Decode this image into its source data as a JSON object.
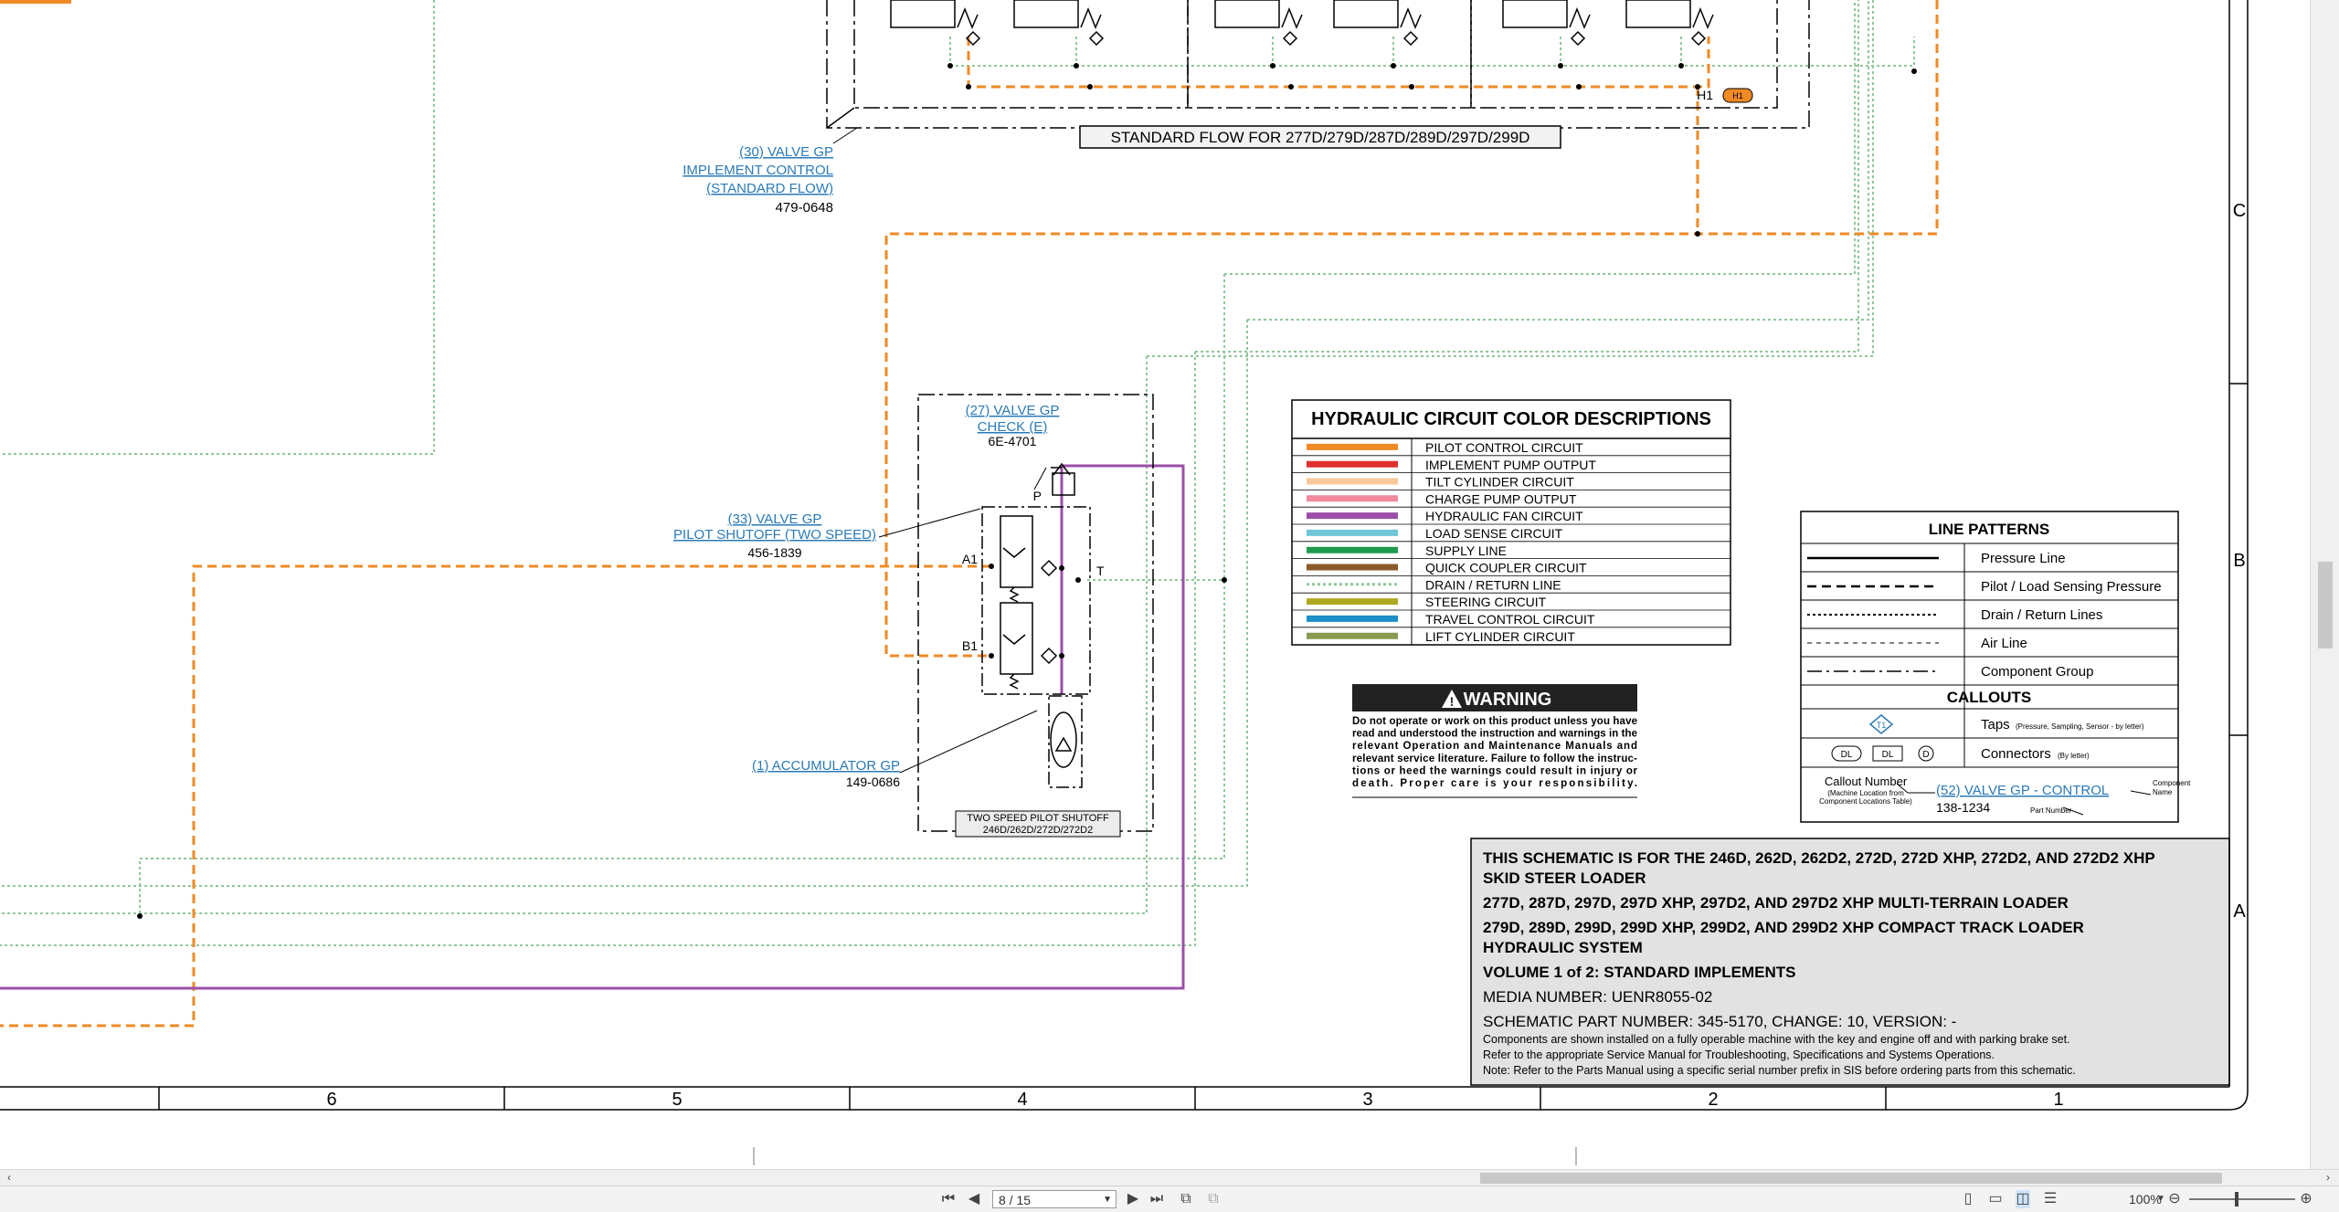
{
  "viewer": {
    "page_indicator": "8 / 15",
    "zoom": "100%",
    "grid_columns": [
      "6",
      "5",
      "4",
      "3",
      "2",
      "1"
    ],
    "grid_rows": [
      "C",
      "B",
      "A"
    ]
  },
  "schematic": {
    "standard_flow_label": "STANDARD FLOW FOR 277D/279D/287D/289D/297D/299D",
    "h1_label": "H1",
    "h1_tag": "H1",
    "valve30": {
      "line1": "(30) VALVE GP",
      "line2": "IMPLEMENT CONTROL",
      "line3": "(STANDARD FLOW)",
      "part": "479-0648"
    },
    "valve27": {
      "line1": "(27) VALVE GP",
      "line2": "CHECK (E)",
      "part": "6E-4701"
    },
    "valve33": {
      "line1": "(33) VALVE GP",
      "line2": "PILOT SHUTOFF (TWO SPEED)",
      "part": "456-1839"
    },
    "accumulator": {
      "line1": "(1) ACCUMULATOR GP",
      "part": "149-0686"
    },
    "port_p": "P",
    "port_t": "T",
    "port_a1": "A1",
    "port_b1": "B1",
    "pilot_box": {
      "line1": "TWO SPEED PILOT SHUTOFF",
      "line2": "246D/262D/272D/272D2"
    }
  },
  "color_table": {
    "title": "HYDRAULIC CIRCUIT COLOR DESCRIPTIONS",
    "rows": [
      {
        "label": "PILOT CONTROL CIRCUIT",
        "color": "#f08a24",
        "style": "solid"
      },
      {
        "label": "IMPLEMENT PUMP OUTPUT",
        "color": "#e03030",
        "style": "solid"
      },
      {
        "label": "TILT CYLINDER CIRCUIT",
        "color": "#f7c99a",
        "style": "solid"
      },
      {
        "label": "CHARGE PUMP OUTPUT",
        "color": "#f08a9a",
        "style": "solid"
      },
      {
        "label": "HYDRAULIC FAN CIRCUIT",
        "color": "#9b4fa8",
        "style": "solid"
      },
      {
        "label": "LOAD SENSE CIRCUIT",
        "color": "#6ec6d8",
        "style": "solid"
      },
      {
        "label": "SUPPLY LINE",
        "color": "#1e9a4e",
        "style": "solid"
      },
      {
        "label": "QUICK COUPLER CIRCUIT",
        "color": "#8b5a2b",
        "style": "solid"
      },
      {
        "label": "DRAIN / RETURN LINE",
        "color": "#8fc79a",
        "style": "dotted"
      },
      {
        "label": "STEERING CIRCUIT",
        "color": "#b0a820",
        "style": "solid"
      },
      {
        "label": "TRAVEL CONTROL CIRCUIT",
        "color": "#1a8fc8",
        "style": "solid"
      },
      {
        "label": "LIFT CYLINDER CIRCUIT",
        "color": "#8a9a50",
        "style": "solid"
      }
    ]
  },
  "warning": {
    "title": "WARNING",
    "lines": [
      "Do not operate or work on this product unless you have",
      "read and understood the instruction and warnings in the",
      "relevant Operation and Maintenance Manuals and",
      "relevant service literature. Failure to follow the instruc-",
      "tions or heed the warnings could result in injury or",
      "death. Proper care is your responsibility."
    ]
  },
  "line_patterns": {
    "title": "LINE PATTERNS",
    "rows": [
      {
        "label": "Pressure Line"
      },
      {
        "label": "Pilot / Load Sensing Pressure"
      },
      {
        "label": "Drain / Return Lines"
      },
      {
        "label": "Air Line"
      },
      {
        "label": "Component Group"
      }
    ],
    "callouts_title": "CALLOUTS",
    "taps_label": "Taps",
    "taps_sub": "(Pressure, Sampling, Sensor - by letter)",
    "connectors_label": "Connectors",
    "connectors_sub": "(By letter)",
    "connector_dl": "DL",
    "connector_d": "D",
    "callout_number": "Callout Number",
    "callout_sub1": "(Machine Location from",
    "callout_sub2": "Component Locations Table)",
    "callout_link": "(52) VALVE GP - CONTROL",
    "callout_part": "138-1234",
    "component_name1": "Component",
    "component_name2": "Name",
    "part_number": "Part Number"
  },
  "title_block": {
    "line1": "THIS SCHEMATIC IS FOR THE 246D, 262D, 262D2, 272D, 272D XHP, 272D2, AND 272D2 XHP",
    "line2": "SKID STEER LOADER",
    "line3": "277D, 287D, 297D, 297D XHP, 297D2, AND 297D2 XHP MULTI-TERRAIN LOADER",
    "line4": "279D, 289D, 299D, 299D XHP, 299D2, AND 299D2 XHP COMPACT TRACK LOADER",
    "line5": "HYDRAULIC SYSTEM",
    "volume": "VOLUME 1 of 2: STANDARD IMPLEMENTS",
    "media": "MEDIA NUMBER: UENR8055-02",
    "part_number": "SCHEMATIC PART NUMBER: 345-5170, CHANGE: 10, VERSION: -",
    "note1": "Components are shown installed on a fully operable machine with the key and engine off and with parking brake set.",
    "note2": "Refer to the appropriate Service Manual for Troubleshooting, Specifications and Systems Operations.",
    "note3": "Note: Refer to the Parts Manual using a specific serial number prefix in SIS before ordering parts from this schematic."
  }
}
